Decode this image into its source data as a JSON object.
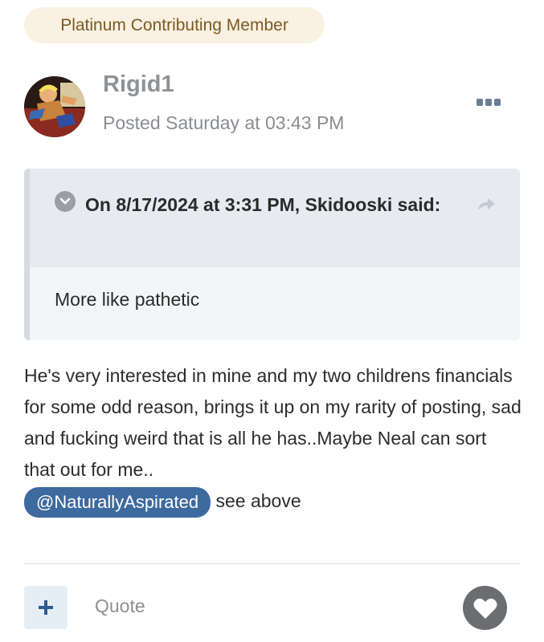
{
  "badge": {
    "label": "Platinum Contributing Member"
  },
  "author": {
    "username": "Rigid1",
    "posted": "Posted Saturday at 03:43 PM"
  },
  "icons": {
    "more": "ellipsis-icon",
    "chevron": "chevron-down-icon",
    "share": "share-arrow-icon",
    "plus": "plus-icon",
    "heart": "heart-icon"
  },
  "quote": {
    "title": "On 8/17/2024 at 3:31 PM, Skidooski said:",
    "body": "More like pathetic"
  },
  "post": {
    "text": "He's very interested in mine and my two childrens financials for some odd reason, brings it up on my rarity of posting, sad and fucking weird that is all he has..Maybe Neal can sort that out for me..",
    "mention": "@NaturallyAspirated",
    "after_mention": " see above"
  },
  "actions": {
    "quote_label": "Quote"
  },
  "colors": {
    "badge_bg": "#fbf1e2",
    "badge_text": "#7a5a25",
    "mention_bg": "#3d6a9f",
    "like_bg": "#6b6d70"
  }
}
